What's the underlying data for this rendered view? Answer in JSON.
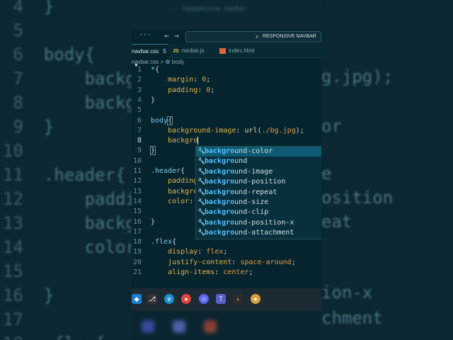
{
  "background_left": {
    "lines": [
      {
        "num": "4",
        "code": "}"
      },
      {
        "num": "5",
        "code": ""
      },
      {
        "num": "6",
        "code": "body{"
      },
      {
        "num": "7",
        "code": "    backgr"
      },
      {
        "num": "8",
        "code": "    backg"
      },
      {
        "num": "9",
        "code": "}"
      },
      {
        "num": "10",
        "code": ""
      },
      {
        "num": "11",
        "code": ".header{"
      },
      {
        "num": "12",
        "code": "    paddi"
      },
      {
        "num": "13",
        "code": "    backg"
      },
      {
        "num": "14",
        "code": "    color"
      },
      {
        "num": "15",
        "code": ""
      },
      {
        "num": "16",
        "code": "}"
      },
      {
        "num": "17",
        "code": ""
      },
      {
        "num": "18",
        "code": ".flex{"
      }
    ]
  },
  "background_right": {
    "lines": [
      "g.jpg);",
      "",
      "or",
      "",
      "e",
      "osition",
      "eat",
      "",
      "",
      "",
      "ion-x",
      "chment"
    ]
  },
  "title_bar": {
    "search_text": "RESPONSIVE NAVBAR",
    "blurred_title": "— responsive navbar"
  },
  "tabs": [
    {
      "label": "navbar.css",
      "modified_count": "5",
      "active": true
    },
    {
      "label": "navbar.js",
      "badge": "JS",
      "active": false
    },
    {
      "label": "index.html",
      "active": false
    }
  ],
  "breadcrumb": {
    "file": "navbar.css",
    "sep": ">",
    "symbol": "body"
  },
  "editor": {
    "line_numbers": [
      "1",
      "2",
      "3",
      "4",
      "5",
      "6",
      "7",
      "8",
      "9",
      "10",
      "11",
      "12",
      "13",
      "14",
      "15",
      "16",
      "17",
      "18",
      "19",
      "20",
      "21"
    ],
    "current_line": "8"
  },
  "suggestions": {
    "typed": "backgro",
    "items": [
      "background-color",
      "background",
      "background-image",
      "background-position",
      "background-repeat",
      "background-size",
      "background-clip",
      "background-position-x",
      "background-attachment"
    ],
    "selected_index": 0
  },
  "taskbar_icons": [
    "vscode-icon",
    "git-icon",
    "edge-icon",
    "chrome-icon",
    "discord-icon",
    "teams-icon",
    "terminal-icon",
    "chrome-dev-icon"
  ]
}
